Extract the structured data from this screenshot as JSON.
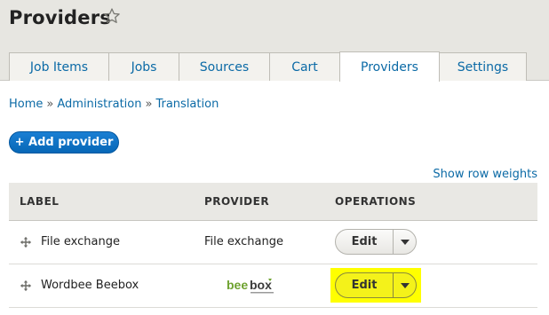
{
  "page": {
    "title": "Providers",
    "star_icon": "star-outline-icon"
  },
  "tabs": [
    {
      "label": "Job Items",
      "active": false
    },
    {
      "label": "Jobs",
      "active": false
    },
    {
      "label": "Sources",
      "active": false
    },
    {
      "label": "Cart",
      "active": false
    },
    {
      "label": "Providers",
      "active": true
    },
    {
      "label": "Settings",
      "active": false
    }
  ],
  "breadcrumb": [
    {
      "label": "Home"
    },
    {
      "label": "Administration"
    },
    {
      "label": "Translation"
    }
  ],
  "breadcrumb_separator": "»",
  "actions": {
    "add_provider": "+ Add provider",
    "row_weights": "Show row weights"
  },
  "table": {
    "headers": {
      "label": "LABEL",
      "provider": "PROVIDER",
      "operations": "OPERATIONS"
    },
    "rows": [
      {
        "label": "File exchange",
        "provider": "File exchange",
        "operation": "Edit",
        "highlighted": false
      },
      {
        "label": "Wordbee Beebox",
        "provider_logo": "beebox",
        "operation": "Edit",
        "highlighted": true
      }
    ]
  },
  "colors": {
    "link": "#0b6aa6",
    "primary_button": "#0971c8",
    "highlight": "#ffff00"
  }
}
